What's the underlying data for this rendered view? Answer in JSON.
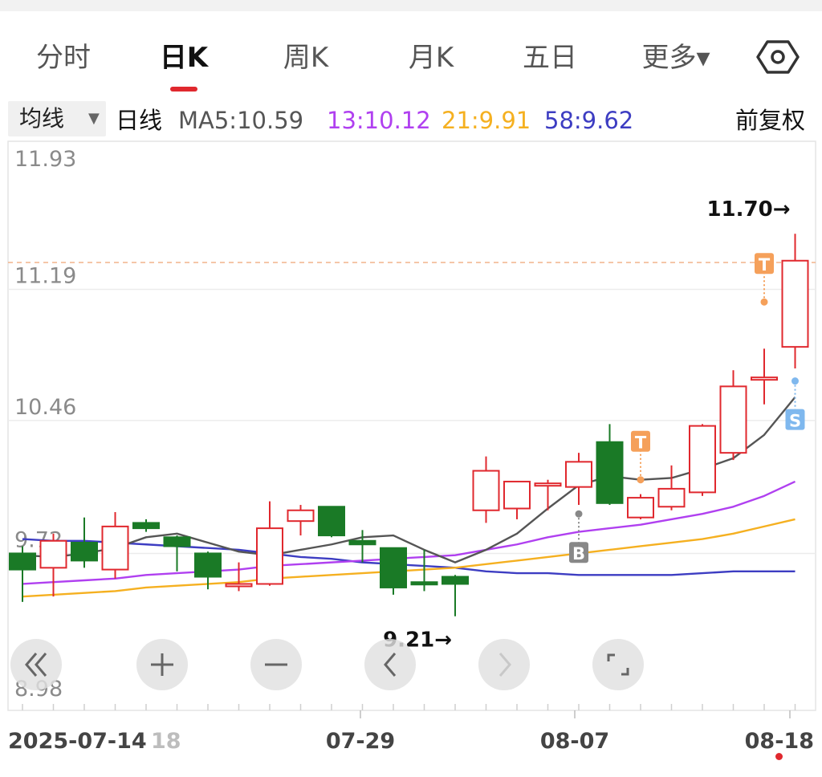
{
  "tabs": [
    {
      "label": "分时",
      "active": false
    },
    {
      "label": "日K",
      "active": true
    },
    {
      "label": "周K",
      "active": false
    },
    {
      "label": "月K",
      "active": false
    },
    {
      "label": "五日",
      "active": false
    },
    {
      "label": "更多▾",
      "active": false
    }
  ],
  "settings_icon": "hexagon-gear-icon",
  "indicator_bar": {
    "ma_button": "均线",
    "ma_caret": "▼",
    "period": "日线",
    "ma5": "MA5:10.59",
    "ma13": "13:10.12",
    "ma21": "21:9.91",
    "ma58": "58:9.62",
    "adjust": "前复权"
  },
  "colors": {
    "up": "#e0282e",
    "down": "#1a7a26",
    "ma5": "#555555",
    "ma13": "#b040f0",
    "ma21": "#f5b020",
    "ma58": "#3d3dc2",
    "marker_T": "#f5a05a",
    "marker_S": "#7fb8ee",
    "marker_B": "#888888"
  },
  "nav_buttons": [
    "double-chevron-left-icon",
    "zoom-in-plus-icon",
    "zoom-out-minus-icon",
    "chevron-left-icon",
    "chevron-right-icon",
    "fullscreen-icon"
  ],
  "chart_data": {
    "type": "candlestick",
    "ylim": [
      8.98,
      11.93
    ],
    "y_ticks": [
      "11.93",
      "11.19",
      "10.46",
      "9.72",
      "8.98"
    ],
    "x_labels": [
      "2025-07-14",
      "18",
      "07-29",
      "08-07",
      "08-18"
    ],
    "reference_price": 11.34,
    "max_annotation": "11.70→",
    "min_annotation": "9.21→",
    "candles": [
      {
        "o": 9.72,
        "h": 9.76,
        "l": 9.45,
        "c": 9.63
      },
      {
        "o": 9.64,
        "h": 9.83,
        "l": 9.48,
        "c": 9.79
      },
      {
        "o": 9.78,
        "h": 9.92,
        "l": 9.64,
        "c": 9.68
      },
      {
        "o": 9.63,
        "h": 9.95,
        "l": 9.58,
        "c": 9.87
      },
      {
        "o": 9.89,
        "h": 9.91,
        "l": 9.84,
        "c": 9.86
      },
      {
        "o": 9.81,
        "h": 9.82,
        "l": 9.62,
        "c": 9.76
      },
      {
        "o": 9.72,
        "h": 9.73,
        "l": 9.52,
        "c": 9.59
      },
      {
        "o": 9.55,
        "h": 9.67,
        "l": 9.51,
        "c": 9.55
      },
      {
        "o": 9.55,
        "h": 10.01,
        "l": 9.54,
        "c": 9.86
      },
      {
        "o": 9.9,
        "h": 9.99,
        "l": 9.82,
        "c": 9.96
      },
      {
        "o": 9.98,
        "h": 9.98,
        "l": 9.81,
        "c": 9.82
      },
      {
        "o": 9.79,
        "h": 9.85,
        "l": 9.67,
        "c": 9.77
      },
      {
        "o": 9.75,
        "h": 9.75,
        "l": 9.49,
        "c": 9.53
      },
      {
        "o": 9.56,
        "h": 9.74,
        "l": 9.51,
        "c": 9.55
      },
      {
        "o": 9.59,
        "h": 9.6,
        "l": 9.37,
        "c": 9.55
      },
      {
        "o": 9.96,
        "h": 10.26,
        "l": 9.89,
        "c": 10.18
      },
      {
        "o": 9.97,
        "h": 10.11,
        "l": 9.91,
        "c": 10.12
      },
      {
        "o": 10.1,
        "h": 10.13,
        "l": 9.96,
        "c": 10.11
      },
      {
        "o": 10.09,
        "h": 10.28,
        "l": 9.99,
        "c": 10.23
      },
      {
        "o": 10.34,
        "h": 10.44,
        "l": 9.99,
        "c": 10.0
      },
      {
        "o": 9.92,
        "h": 10.05,
        "l": 9.91,
        "c": 10.03
      },
      {
        "o": 9.98,
        "h": 10.21,
        "l": 9.96,
        "c": 10.08
      },
      {
        "o": 10.06,
        "h": 10.44,
        "l": 10.04,
        "c": 10.43
      },
      {
        "o": 10.28,
        "h": 10.74,
        "l": 10.24,
        "c": 10.65
      },
      {
        "o": 10.7,
        "h": 10.86,
        "l": 10.55,
        "c": 10.7
      },
      {
        "o": 10.87,
        "h": 11.5,
        "l": 10.75,
        "c": 11.35
      }
    ],
    "ma5": [
      9.71,
      9.7,
      9.72,
      9.75,
      9.81,
      9.83,
      9.78,
      9.73,
      9.71,
      9.74,
      9.77,
      9.81,
      9.82,
      9.74,
      9.67,
      9.74,
      9.83,
      9.97,
      10.1,
      10.15,
      10.13,
      10.14,
      10.19,
      10.25,
      10.38,
      10.59
    ],
    "ma13": [
      9.55,
      9.56,
      9.57,
      9.58,
      9.6,
      9.61,
      9.62,
      9.63,
      9.65,
      9.66,
      9.67,
      9.68,
      9.69,
      9.7,
      9.71,
      9.74,
      9.77,
      9.81,
      9.84,
      9.86,
      9.88,
      9.91,
      9.94,
      9.98,
      10.04,
      10.12
    ],
    "ma21": [
      9.48,
      9.49,
      9.5,
      9.51,
      9.53,
      9.54,
      9.55,
      9.56,
      9.58,
      9.59,
      9.6,
      9.61,
      9.62,
      9.63,
      9.64,
      9.66,
      9.68,
      9.7,
      9.72,
      9.74,
      9.76,
      9.78,
      9.8,
      9.83,
      9.87,
      9.91
    ],
    "ma58": [
      9.8,
      9.79,
      9.79,
      9.78,
      9.77,
      9.76,
      9.75,
      9.74,
      9.72,
      9.7,
      9.69,
      9.67,
      9.66,
      9.65,
      9.64,
      9.62,
      9.61,
      9.61,
      9.6,
      9.6,
      9.6,
      9.6,
      9.61,
      9.62,
      9.62,
      9.62
    ],
    "markers": [
      {
        "label": "T",
        "index": 20,
        "price": 10.13,
        "color": "#f5a05a",
        "side": "above"
      },
      {
        "label": "B",
        "index": 18,
        "price": 9.94,
        "color": "#888888",
        "side": "below"
      },
      {
        "label": "T",
        "index": 24,
        "price": 11.12,
        "color": "#f5a05a",
        "side": "above"
      },
      {
        "label": "S",
        "index": 25,
        "price": 10.68,
        "color": "#7fb8ee",
        "side": "below"
      }
    ]
  }
}
